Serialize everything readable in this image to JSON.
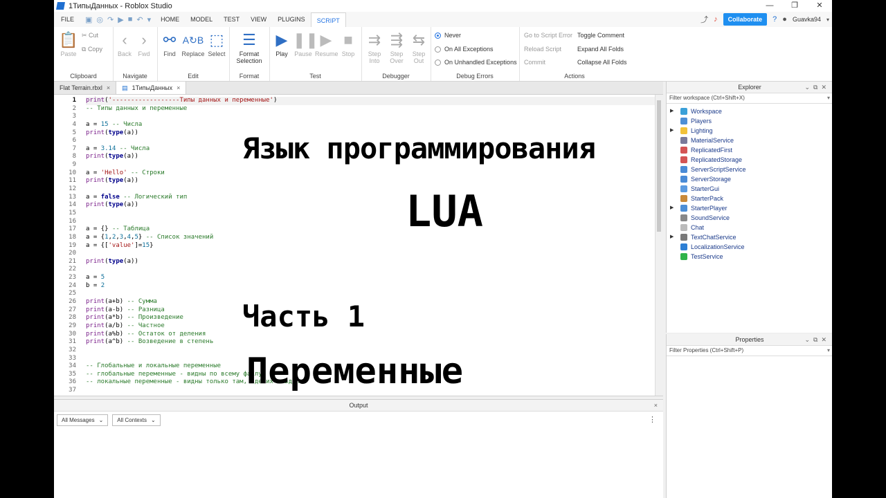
{
  "window": {
    "title": "1ТипыДанных - Roblox Studio",
    "controls": [
      "—",
      "❐",
      "✕"
    ]
  },
  "menu": {
    "file": "FILE",
    "tabs": [
      "HOME",
      "MODEL",
      "TEST",
      "VIEW",
      "PLUGINS",
      "SCRIPT"
    ],
    "active_tab": "SCRIPT",
    "collaborate": "Collaborate",
    "username": "Guavka94"
  },
  "ribbon": {
    "clipboard": {
      "label": "Clipboard",
      "paste": "Paste",
      "cut": "Cut",
      "copy": "Copy"
    },
    "navigate": {
      "label": "Navigate",
      "back": "Back",
      "fwd": "Fwd"
    },
    "edit": {
      "label": "Edit",
      "find": "Find",
      "replace": "Replace",
      "select": "Select"
    },
    "format": {
      "label": "Format",
      "format_selection_1": "Format",
      "format_selection_2": "Selection"
    },
    "test": {
      "label": "Test",
      "play": "Play",
      "pause": "Pause",
      "resume": "Resume",
      "stop": "Stop"
    },
    "debugger": {
      "label": "Debugger",
      "step_into_1": "Step",
      "step_into_2": "Into",
      "step_over_1": "Step",
      "step_over_2": "Over",
      "step_out_1": "Step",
      "step_out_2": "Out"
    },
    "debug_errors": {
      "label": "Debug Errors",
      "never": "Never",
      "all": "On All Exceptions",
      "unhandled": "On Unhandled Exceptions"
    },
    "actions": {
      "label": "Actions",
      "go_to_error": "Go to Script Error",
      "reload": "Reload Script",
      "commit": "Commit",
      "toggle_comment": "Toggle Comment",
      "expand": "Expand All Folds",
      "collapse": "Collapse All Folds"
    }
  },
  "editor_tabs": [
    {
      "label": "Flat Terrain.rbxl",
      "close": "×"
    },
    {
      "label": "1ТипыДанных",
      "close": "×"
    }
  ],
  "editor": {
    "current_line": 1,
    "lines": [
      [
        [
          "fn",
          "print"
        ],
        [
          "",
          "("
        ],
        [
          "st",
          "'------------------Типы данных и переменные'"
        ],
        [
          "",
          ")"
        ]
      ],
      [
        [
          "cm",
          "-- Типы данных и переменные"
        ]
      ],
      [],
      [
        [
          "",
          "a = "
        ],
        [
          "nm",
          "15"
        ],
        [
          "cm",
          " -- Числа"
        ]
      ],
      [
        [
          "fn",
          "print"
        ],
        [
          "",
          "("
        ],
        [
          "kw",
          "type"
        ],
        [
          "",
          "(a))"
        ]
      ],
      [],
      [
        [
          "",
          "a = "
        ],
        [
          "nm",
          "3.14"
        ],
        [
          "cm",
          " -- Числа"
        ]
      ],
      [
        [
          "fn",
          "print"
        ],
        [
          "",
          "("
        ],
        [
          "kw",
          "type"
        ],
        [
          "",
          "(a))"
        ]
      ],
      [],
      [
        [
          "",
          "a = "
        ],
        [
          "st",
          "'Hello'"
        ],
        [
          "cm",
          " -- Строки"
        ]
      ],
      [
        [
          "fn",
          "print"
        ],
        [
          "",
          "("
        ],
        [
          "kw",
          "type"
        ],
        [
          "",
          "(a))"
        ]
      ],
      [],
      [
        [
          "",
          "a = "
        ],
        [
          "kw",
          "false"
        ],
        [
          "cm",
          " -- Логический тип"
        ]
      ],
      [
        [
          "fn",
          "print"
        ],
        [
          "",
          "("
        ],
        [
          "kw",
          "type"
        ],
        [
          "",
          "(a))"
        ]
      ],
      [],
      [],
      [
        [
          "",
          "a = {} "
        ],
        [
          "cm",
          "-- Таблица"
        ]
      ],
      [
        [
          "",
          "a = {"
        ],
        [
          "nm",
          "1"
        ],
        [
          "",
          ","
        ],
        [
          "nm",
          "2"
        ],
        [
          "",
          ","
        ],
        [
          "nm",
          "3"
        ],
        [
          "",
          ","
        ],
        [
          "nm",
          "4"
        ],
        [
          "",
          ","
        ],
        [
          "nm",
          "5"
        ],
        [
          "",
          "} "
        ],
        [
          "cm",
          "-- Список значений"
        ]
      ],
      [
        [
          "",
          "a = {["
        ],
        [
          "st",
          "'value'"
        ],
        [
          "",
          "]="
        ],
        [
          "nm",
          "15"
        ],
        [
          "",
          "}"
        ]
      ],
      [],
      [
        [
          "fn",
          "print"
        ],
        [
          "",
          "("
        ],
        [
          "kw",
          "type"
        ],
        [
          "",
          "(a))"
        ]
      ],
      [],
      [
        [
          "",
          "a = "
        ],
        [
          "nm",
          "5"
        ]
      ],
      [
        [
          "",
          "b = "
        ],
        [
          "nm",
          "2"
        ]
      ],
      [],
      [
        [
          "fn",
          "print"
        ],
        [
          "",
          "(a+b) "
        ],
        [
          "cm",
          "-- Сумма"
        ]
      ],
      [
        [
          "fn",
          "print"
        ],
        [
          "",
          "(a-b) "
        ],
        [
          "cm",
          "-- Разница"
        ]
      ],
      [
        [
          "fn",
          "print"
        ],
        [
          "",
          "(a*b) "
        ],
        [
          "cm",
          "-- Произведение"
        ]
      ],
      [
        [
          "fn",
          "print"
        ],
        [
          "",
          "(a/b) "
        ],
        [
          "cm",
          "-- Частное"
        ]
      ],
      [
        [
          "fn",
          "print"
        ],
        [
          "",
          "(a%b) "
        ],
        [
          "cm",
          "-- Остаток от деления"
        ]
      ],
      [
        [
          "fn",
          "print"
        ],
        [
          "",
          "(a^b) "
        ],
        [
          "cm",
          "-- Возведение в степень"
        ]
      ],
      [],
      [],
      [
        [
          "cm",
          "-- Глобальные и локальные переменные"
        ]
      ],
      [
        [
          "cm",
          "-- глобальные переменные - видны по всему файлу"
        ]
      ],
      [
        [
          "cm",
          "-- локальные переменные - видны только там, где их создали"
        ]
      ],
      []
    ]
  },
  "overlay": {
    "line1": "Язык программирования",
    "line2": "LUA",
    "line3": "Часть 1",
    "line4": "Переменные"
  },
  "output": {
    "title": "Output",
    "close": "×",
    "messages_filter": "All Messages",
    "contexts_filter": "All Contexts"
  },
  "explorer": {
    "title": "Explorer",
    "filter_placeholder": "Filter workspace (Ctrl+Shift+X)",
    "items": [
      {
        "label": "Workspace",
        "expandable": true,
        "color": "#3aa0d8"
      },
      {
        "label": "Players",
        "expandable": false,
        "color": "#4d8fd6"
      },
      {
        "label": "Lighting",
        "expandable": true,
        "color": "#f2c23a"
      },
      {
        "label": "MaterialService",
        "expandable": false,
        "color": "#7a7a9a"
      },
      {
        "label": "ReplicatedFirst",
        "expandable": false,
        "color": "#d45454"
      },
      {
        "label": "ReplicatedStorage",
        "expandable": false,
        "color": "#d45454"
      },
      {
        "label": "ServerScriptService",
        "expandable": false,
        "color": "#4a8bd6"
      },
      {
        "label": "ServerStorage",
        "expandable": false,
        "color": "#4a8bd6"
      },
      {
        "label": "StarterGui",
        "expandable": false,
        "color": "#5c9be0"
      },
      {
        "label": "StarterPack",
        "expandable": false,
        "color": "#c98a3a"
      },
      {
        "label": "StarterPlayer",
        "expandable": true,
        "color": "#4d8fd6"
      },
      {
        "label": "SoundService",
        "expandable": false,
        "color": "#888888"
      },
      {
        "label": "Chat",
        "expandable": false,
        "color": "#bbbbbb"
      },
      {
        "label": "TextChatService",
        "expandable": true,
        "color": "#7a7a7a"
      },
      {
        "label": "LocalizationService",
        "expandable": false,
        "color": "#2d7fd4"
      },
      {
        "label": "TestService",
        "expandable": false,
        "color": "#2fb34a"
      }
    ]
  },
  "properties": {
    "title": "Properties",
    "filter_placeholder": "Filter Properties (Ctrl+Shift+P)"
  }
}
